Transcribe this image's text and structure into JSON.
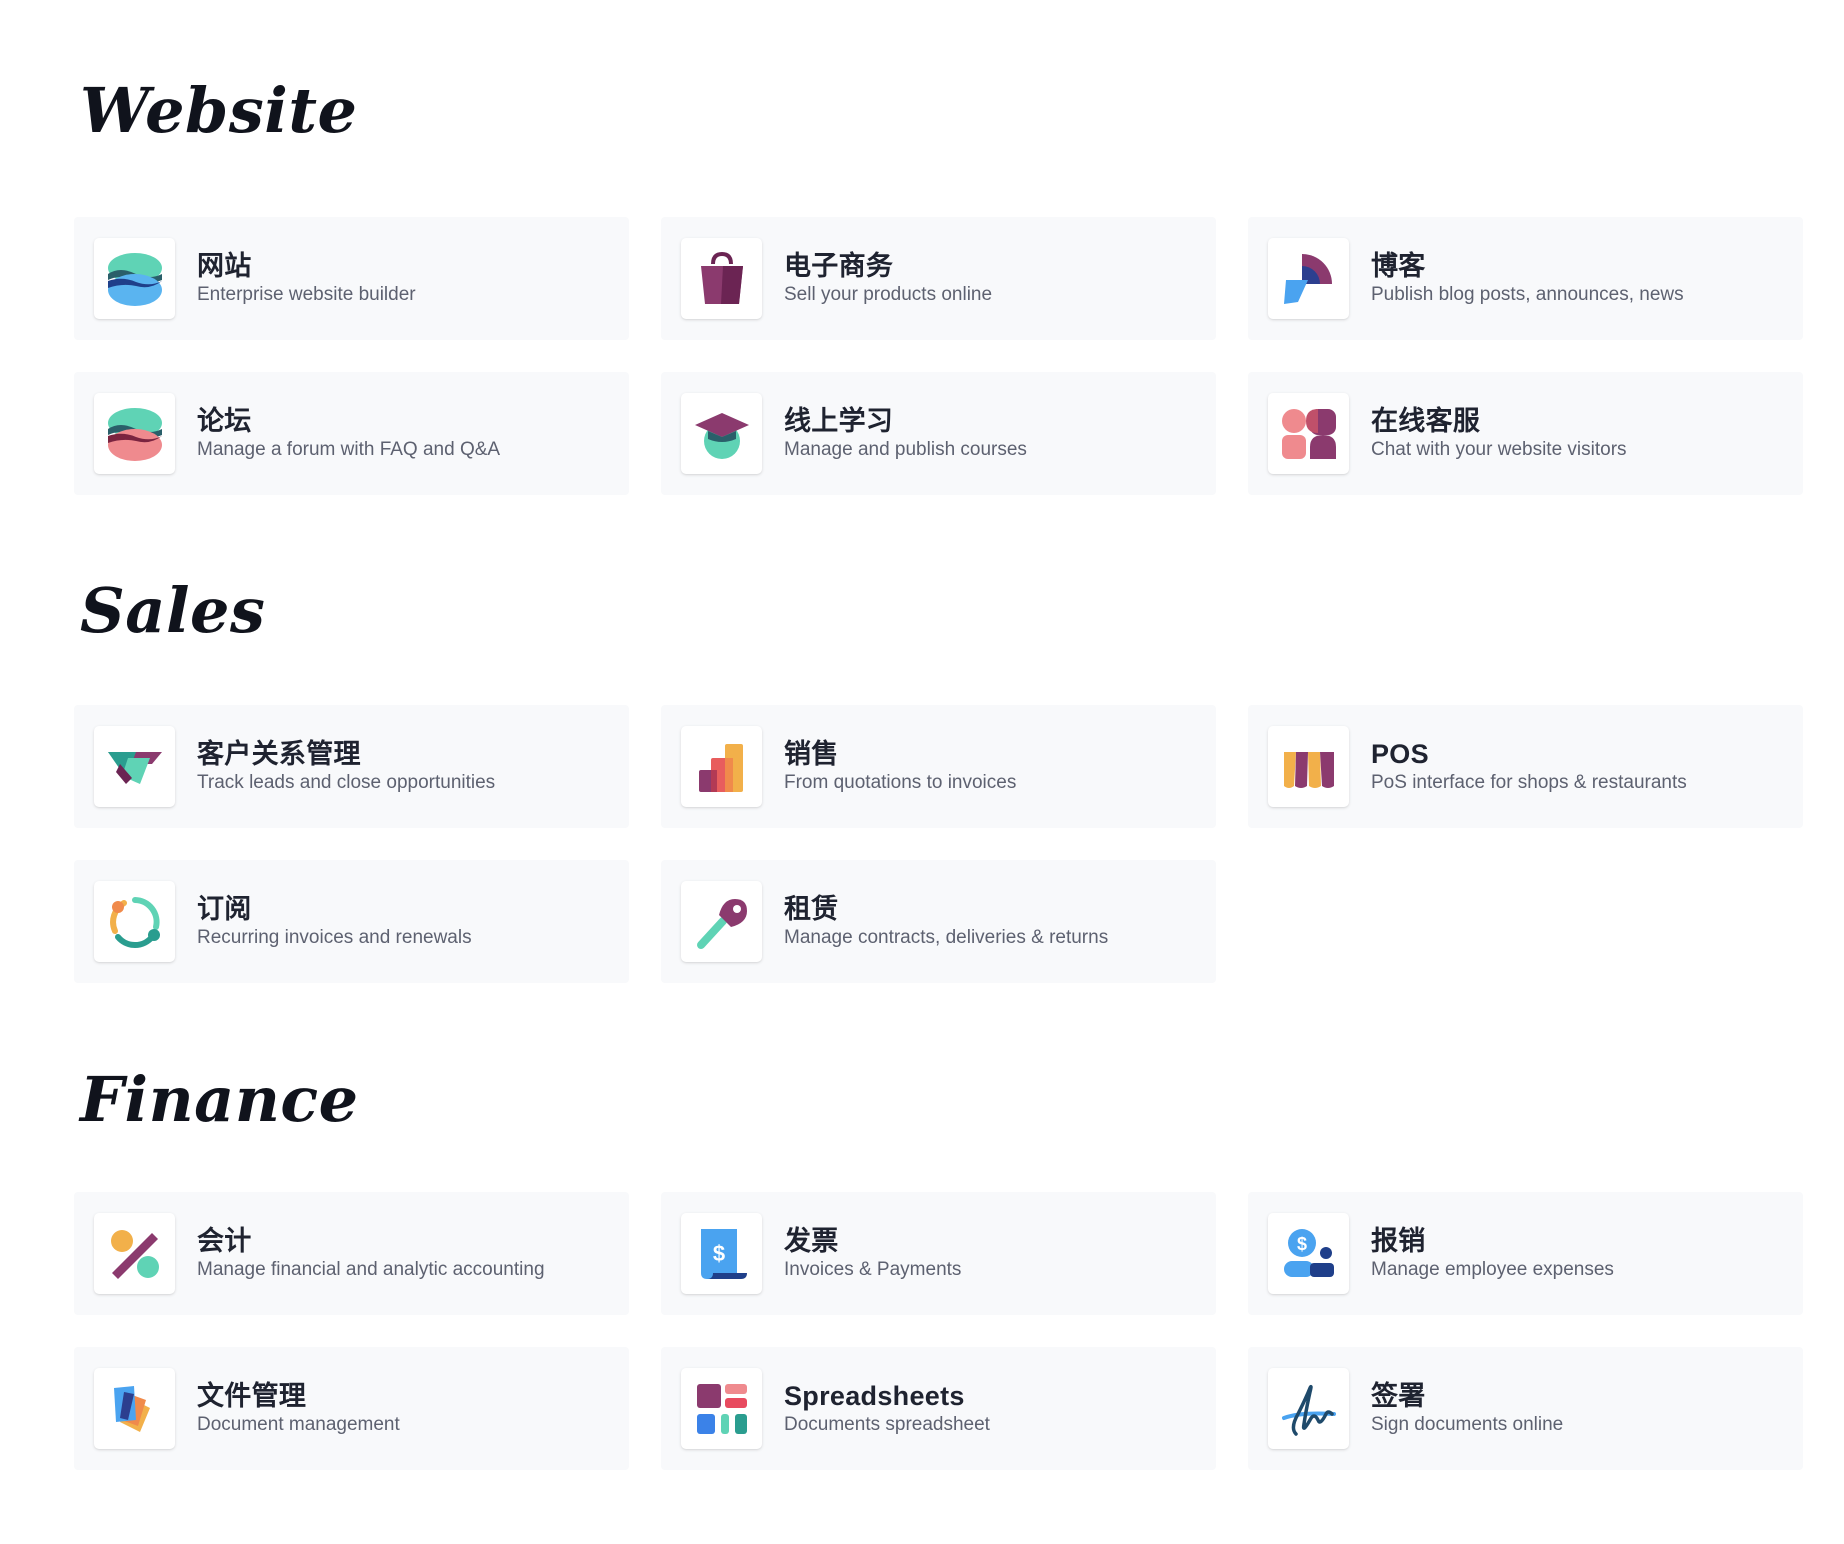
{
  "sections": [
    {
      "title": "Website",
      "apps": [
        {
          "name": "网站",
          "description": "Enterprise website builder",
          "icon": "website-icon"
        },
        {
          "name": "电子商务",
          "description": "Sell your products online",
          "icon": "shopping-bag-icon"
        },
        {
          "name": "博客",
          "description": "Publish blog posts, announces, news",
          "icon": "blog-icon"
        },
        {
          "name": "论坛",
          "description": "Manage a forum with FAQ and Q&A",
          "icon": "forum-icon"
        },
        {
          "name": "线上学习",
          "description": "Manage and publish courses",
          "icon": "graduation-cap-icon"
        },
        {
          "name": "在线客服",
          "description": "Chat with your website visitors",
          "icon": "live-chat-icon"
        }
      ]
    },
    {
      "title": "Sales",
      "apps": [
        {
          "name": "客户关系管理",
          "description": "Track leads and close opportunities",
          "icon": "handshake-icon"
        },
        {
          "name": "销售",
          "description": "From quotations to invoices",
          "icon": "bar-chart-icon"
        },
        {
          "name": "POS",
          "description": "PoS interface for shops & restaurants",
          "icon": "shop-awning-icon"
        },
        {
          "name": "订阅",
          "description": "Recurring invoices and renewals",
          "icon": "recurring-circle-icon"
        },
        {
          "name": "租赁",
          "description": "Manage contracts, deliveries & returns",
          "icon": "key-icon"
        }
      ]
    },
    {
      "title": "Finance",
      "apps": [
        {
          "name": "会计",
          "description": "Manage financial and analytic accounting",
          "icon": "percent-icon"
        },
        {
          "name": "发票",
          "description": "Invoices & Payments",
          "icon": "invoice-dollar-icon"
        },
        {
          "name": "报销",
          "description": "Manage employee expenses",
          "icon": "expense-person-icon"
        },
        {
          "name": "文件管理",
          "description": "Document management",
          "icon": "documents-icon"
        },
        {
          "name": "Spreadsheets",
          "description": "Documents spreadsheet",
          "icon": "spreadsheet-icon"
        },
        {
          "name": "签署",
          "description": "Sign documents online",
          "icon": "signature-icon"
        }
      ]
    }
  ]
}
